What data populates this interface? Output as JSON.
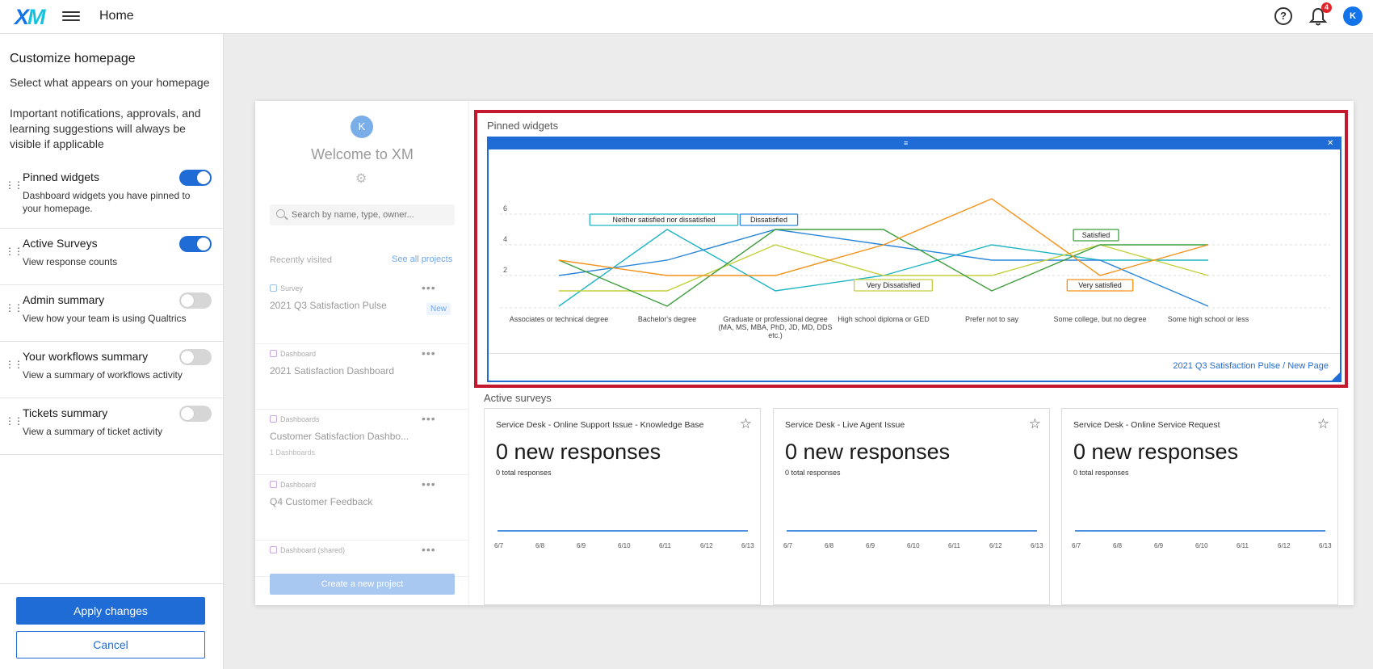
{
  "topbar": {
    "logo": "XM",
    "page_name": "Home",
    "help_label": "?",
    "notification_count": "4",
    "user_initial": "K"
  },
  "left_panel": {
    "title": "Customize homepage",
    "subtitle": "Select what appears on your homepage",
    "note": "Important notifications, approvals, and learning suggestions will always be visible if applicable",
    "settings": [
      {
        "title": "Pinned widgets",
        "desc": "Dashboard widgets you have pinned to your homepage.",
        "enabled": true
      },
      {
        "title": "Active Surveys",
        "desc": "View response counts",
        "enabled": true
      },
      {
        "title": "Admin summary",
        "desc": "View how your team is using Qualtrics",
        "enabled": false
      },
      {
        "title": "Your workflows summary",
        "desc": "View a summary of workflows activity",
        "enabled": false
      },
      {
        "title": "Tickets summary",
        "desc": "View a summary of ticket activity",
        "enabled": false
      }
    ],
    "apply_label": "Apply changes",
    "cancel_label": "Cancel"
  },
  "preview": {
    "welcome": {
      "avatar": "K",
      "title": "Welcome to XM",
      "search_placeholder": "Search by name, type, owner...",
      "recently_visited": "Recently visited",
      "see_all": "See all projects",
      "items": [
        {
          "type": "Survey",
          "name": "2021 Q3 Satisfaction Pulse",
          "badge": "New",
          "meta": ""
        },
        {
          "type": "Dashboard",
          "name": "2021 Satisfaction Dashboard",
          "badge": "",
          "meta": ""
        },
        {
          "type": "Dashboards",
          "name": "Customer Satisfaction Dashbo...",
          "badge": "",
          "meta": "1 Dashboards"
        },
        {
          "type": "Dashboard",
          "name": "Q4 Customer Feedback",
          "badge": "",
          "meta": ""
        },
        {
          "type": "Dashboard (shared)",
          "name": "",
          "badge": "",
          "meta": ""
        }
      ],
      "create_label": "Create a new project"
    },
    "pinned": {
      "label": "Pinned widgets",
      "link": "2021 Q3 Satisfaction Pulse / New Page"
    },
    "active_surveys": {
      "label": "Active surveys",
      "cards": [
        {
          "title": "Service Desk - Online Support Issue - Knowledge Base",
          "count": "0 new responses",
          "total": "0 total responses"
        },
        {
          "title": "Service Desk - Live Agent Issue",
          "count": "0 new responses",
          "total": "0 total responses"
        },
        {
          "title": "Service Desk - Online Service Request",
          "count": "0 new responses",
          "total": "0 total responses"
        }
      ],
      "date_ticks": [
        "6/7",
        "6/8",
        "6/9",
        "6/10",
        "6/11",
        "6/12",
        "6/13"
      ]
    }
  },
  "chart_data": {
    "type": "line",
    "categories": [
      "Associates or technical degree",
      "Bachelor's degree",
      "Graduate or professional degree (MA, MS, MBA, PhD, JD, MD, DDS etc.)",
      "High school diploma or GED",
      "Prefer not to say",
      "Some college, but no degree",
      "Some high school or less"
    ],
    "ylim": [
      0,
      7
    ],
    "yticks": [
      2,
      4,
      6
    ],
    "grid": true,
    "series": [
      {
        "name": "Neither satisfied nor dissatisfied",
        "color": "#1fb5c4",
        "values": [
          0,
          5,
          1,
          2,
          4,
          3,
          3
        ]
      },
      {
        "name": "Dissatisfied",
        "color": "#2a86d8",
        "values": [
          2,
          3,
          5,
          4,
          3,
          3,
          0
        ]
      },
      {
        "name": "Very Dissatisfied",
        "color": "#c4cf3a",
        "values": [
          1,
          1,
          4,
          2,
          2,
          4,
          2
        ]
      },
      {
        "name": "Satisfied",
        "color": "#3e9e3e",
        "values": [
          3,
          0,
          5,
          5,
          1,
          4,
          4
        ]
      },
      {
        "name": "Very satisfied",
        "color": "#f39219",
        "values": [
          3,
          2,
          2,
          4,
          7,
          2,
          4
        ]
      }
    ],
    "annotations": [
      {
        "text": "Neither satisfied nor dissatisfied",
        "series": 0,
        "point": 1
      },
      {
        "text": "Dissatisfied",
        "series": 1,
        "point": 2
      },
      {
        "text": "Very Dissatisfied",
        "series": 2,
        "point": 3
      },
      {
        "text": "Satisfied",
        "series": 3,
        "point": 5
      },
      {
        "text": "Very satisfied",
        "series": 4,
        "point": 5
      }
    ]
  }
}
